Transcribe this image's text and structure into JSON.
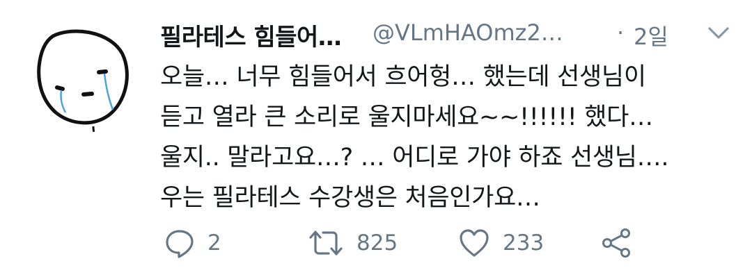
{
  "tweet": {
    "author": {
      "display_name": "필라테스 힘들어…",
      "handle": "@VLmHAOmz2…",
      "avatar_icon": "crying-face-doodle-avatar"
    },
    "meta": {
      "separator": "·",
      "time": "2일",
      "caret_icon": "chevron-down-icon"
    },
    "text_lines": [
      "오늘… 너무 힘들어서 흐어헝… 했는데 선생님이",
      "듣고 열라 큰 소리로 울지마세요~~!!!!!! 했다…",
      "울지.. 말라고요…? … 어디로 가야 하죠 선생님….",
      "우는 필라테스 수강생은 처음인가요…"
    ],
    "actions": {
      "reply": {
        "icon": "reply-bubble-icon",
        "count": "2"
      },
      "retweet": {
        "icon": "retweet-icon",
        "count": "825"
      },
      "like": {
        "icon": "heart-icon",
        "count": "233"
      },
      "share": {
        "icon": "share-icon"
      }
    },
    "colors": {
      "text": "#14171a",
      "secondary": "#657786",
      "tear": "#4aa3df"
    }
  }
}
